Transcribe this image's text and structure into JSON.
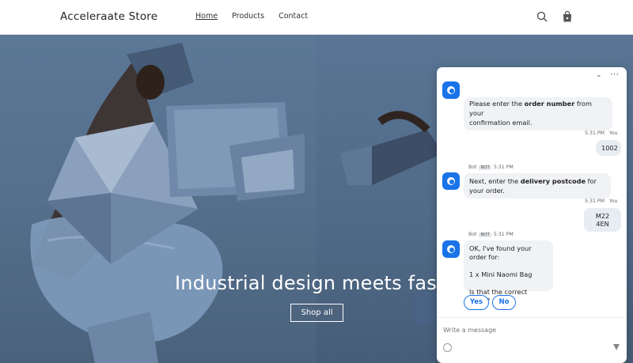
{
  "header": {
    "brand": "Acceleraate Store",
    "nav": [
      "Home",
      "Products",
      "Contact"
    ],
    "active_nav": "Home",
    "icons": [
      "search-icon",
      "shopping-bag-icon"
    ]
  },
  "hero": {
    "title": "Industrial design meets fashio",
    "cta": "Shop all"
  },
  "chat": {
    "messages": {
      "bot_1_text": "Please enter the order number from your confirmation email.",
      "bot_1_line1_pre": "Please enter the ",
      "bot_1_line1_bold": "order number",
      "bot_1_line1_post": " from your",
      "bot_1_line2": "confirmation email.",
      "user_1_meta_time": "5:31 PM",
      "user_1_meta_who": "You",
      "user_1_text": "1002",
      "bot_2_meta_name": "Bot",
      "bot_2_meta_badge": "BOT",
      "bot_2_meta_time": "5:31 PM",
      "bot_2_pre": "Next, enter the ",
      "bot_2_bold": "delivery postcode",
      "bot_2_post": " for your order.",
      "user_2_meta_time": "5:31 PM",
      "user_2_meta_who": "You",
      "user_2_text": "M22 4EN",
      "bot_3_meta_name": "Bot",
      "bot_3_meta_badge": "BOT",
      "bot_3_meta_time": "5:31 PM",
      "bot_3_line1": "OK, I've found your order for:",
      "bot_3_line2": "1 x Mini Naomi Bag",
      "bot_3_line3": "Is that the correct order?"
    },
    "quick_replies": [
      "Yes",
      "No"
    ],
    "composer_placeholder": "Write a message",
    "colors": {
      "accent": "#1a73e8"
    }
  }
}
